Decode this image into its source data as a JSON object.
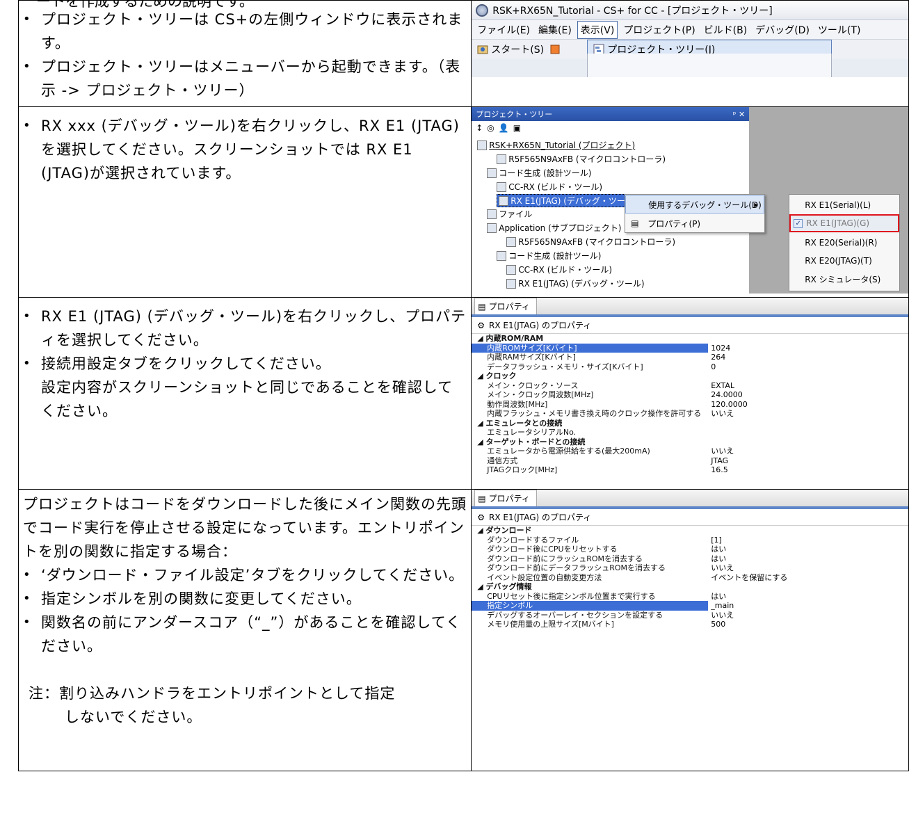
{
  "top_cut_text": "ートを作成するための説明です。",
  "rows": [
    {
      "text": {
        "bullets": [
          "プロジェクト・ツリーは CS+の左側ウィンドウに表示されます。",
          "プロジェクト・ツリーはメニューバーから起動できます。（表示 -> プロジェクト・ツリー）"
        ]
      },
      "shot": {
        "title": "RSK+RX65N_Tutorial - CS+ for CC - [プロジェクト・ツリー]",
        "menu": [
          "ファイル(E)",
          "編集(E)",
          "表示(V)",
          "プロジェクト(P)",
          "ビルド(B)",
          "デバッグ(D)",
          "ツール(T)"
        ],
        "start_label": "スタート(S)",
        "dropdown_item": "プロジェクト・ツリー(J)"
      }
    },
    {
      "text": {
        "bullets": [
          "RX xxx (デバッグ・ツール)を右クリックし、RX E1 (JTAG)を選択してください。スクリーンショットでは RX E1 (JTAG)が選択されています。"
        ]
      },
      "shot": {
        "panel_title": "プロジェクト・ツリー",
        "panel_controls": "ᵖ ✕",
        "tree": [
          "RSK+RX65N_Tutorial (プロジェクト)",
          "R5F565N9AxFB (マイクロコントローラ)",
          "コード生成 (設計ツール)",
          "CC-RX (ビルド・ツール)",
          "RX E1(JTAG) (デバッグ・ツール)",
          "ファイル",
          "Application (サブプロジェクト)",
          "R5F565N9AxFB (マイクロコントローラ)",
          "コード生成 (設計ツール)",
          "CC-RX (ビルド・ツール)",
          "RX E1(JTAG) (デバッグ・ツール)"
        ],
        "context_menu": [
          "使用するデバッグ・ツール(D)",
          "プロパティ(P)"
        ],
        "submenu": [
          "RX E1(Serial)(L)",
          "RX E1(JTAG)(G)",
          "RX E20(Serial)(R)",
          "RX E20(JTAG)(T)",
          "RX シミュレータ(S)"
        ]
      }
    },
    {
      "text": {
        "bullets": [
          "RX E1 (JTAG) (デバッグ・ツール)を右クリックし、プロパティを選択してください。",
          "接続用設定タブをクリックしてください。"
        ],
        "after": "設定内容がスクリーンショットと同じであることを確認してください。"
      },
      "shot": {
        "tab": "プロパティ",
        "header": "RX E1(JTAG) のプロパティ",
        "rows": [
          {
            "k": "内蔵ROM/RAM",
            "v": "",
            "cat": true
          },
          {
            "k": "内蔵ROMサイズ[Kバイト]",
            "v": "1024",
            "hl": true
          },
          {
            "k": "内蔵RAMサイズ[Kバイト]",
            "v": "264"
          },
          {
            "k": "データフラッシュ・メモリ・サイズ[Kバイト]",
            "v": "0"
          },
          {
            "k": "クロック",
            "v": "",
            "cat": true
          },
          {
            "k": "メイン・クロック・ソース",
            "v": "EXTAL"
          },
          {
            "k": "メイン・クロック周波数[MHz]",
            "v": "24.0000"
          },
          {
            "k": "動作周波数[MHz]",
            "v": "120.0000"
          },
          {
            "k": "内蔵フラッシュ・メモリ書き換え時のクロック操作を許可する",
            "v": "いいえ"
          },
          {
            "k": "エミュレータとの接続",
            "v": "",
            "cat": true
          },
          {
            "k": "エミュレータシリアルNo.",
            "v": ""
          },
          {
            "k": "ターゲット・ボードとの接続",
            "v": "",
            "cat": true
          },
          {
            "k": "エミュレータから電源供給をする(最大200mA)",
            "v": "いいえ"
          },
          {
            "k": "通信方式",
            "v": "JTAG"
          },
          {
            "k": "JTAGクロック[MHz]",
            "v": "16.5"
          }
        ]
      }
    },
    {
      "text": {
        "intro": "プロジェクトはコードをダウンロードした後にメイン関数の先頭でコード実行を停止させる設定になっています。エントリポイントを別の関数に指定する場合：",
        "bullets": [
          "‘ダウンロード・ファイル設定’タブをクリックしてください。",
          "指定シンボルを別の関数に変更してください。",
          "関数名の前にアンダースコア（“_”）があることを確認してください。"
        ],
        "note_line1": "注：割り込みハンドラをエントリポイントとして指定",
        "note_line2": "しないでください。"
      },
      "shot": {
        "tab": "プロパティ",
        "header": "RX E1(JTAG) のプロパティ",
        "rows": [
          {
            "k": "ダウンロード",
            "v": "",
            "cat": true
          },
          {
            "k": "ダウンロードするファイル",
            "v": "[1]"
          },
          {
            "k": "ダウンロード後にCPUをリセットする",
            "v": "はい"
          },
          {
            "k": "ダウンロード前にフラッシュROMを消去する",
            "v": "はい"
          },
          {
            "k": "ダウンロード前にデータフラッシュROMを消去する",
            "v": "いいえ"
          },
          {
            "k": "イベント設定位置の自動変更方法",
            "v": "イベントを保留にする"
          },
          {
            "k": "デバッグ情報",
            "v": "",
            "cat": true
          },
          {
            "k": "CPUリセット後に指定シンボル位置まで実行する",
            "v": "はい"
          },
          {
            "k": "指定シンボル",
            "v": "_main",
            "hl": true
          },
          {
            "k": "デバッグするオーバーレイ・セクションを設定する",
            "v": "いいえ"
          },
          {
            "k": "メモリ使用量の上限サイズ[Mバイト]",
            "v": "500"
          }
        ]
      }
    }
  ]
}
